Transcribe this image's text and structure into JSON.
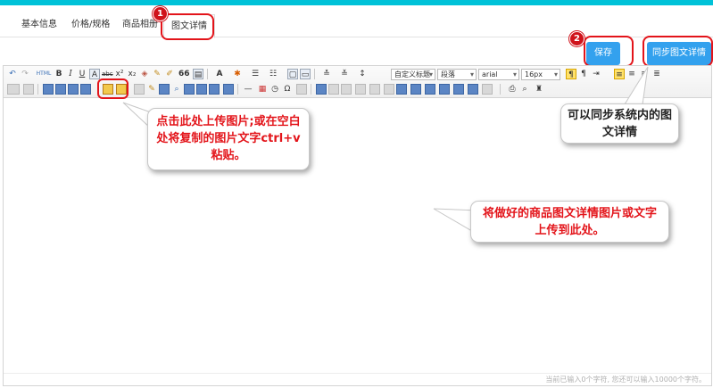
{
  "tabs": [
    {
      "label": "基本信息"
    },
    {
      "label": "价格/规格"
    },
    {
      "label": "商品相册"
    },
    {
      "label": "图文详情",
      "active": true
    }
  ],
  "actions": {
    "save_label": "保存",
    "sync_label": "同步图文详情"
  },
  "badges": {
    "tab_step": "1",
    "save_step": "2"
  },
  "toolbar": {
    "custom_heading": "自定义标题",
    "paragraph": "段落",
    "font_family": "arial",
    "font_size": "16px",
    "html_label": "HTML",
    "quote_label": "66"
  },
  "status": {
    "word_count": "当前已输入0个字符, 您还可以输入10000个字符。"
  },
  "callouts": {
    "upload": "点击此处上传图片;或在空白处将复制的图片文字ctrl+v粘贴。",
    "sync": "可以同步系统内的图文详情",
    "content": "将做好的商品图文详情图片或文字上传到此处。"
  },
  "colors": {
    "accent": "#00c2d8",
    "button": "#33a1ee",
    "highlight": "#e3141a"
  }
}
